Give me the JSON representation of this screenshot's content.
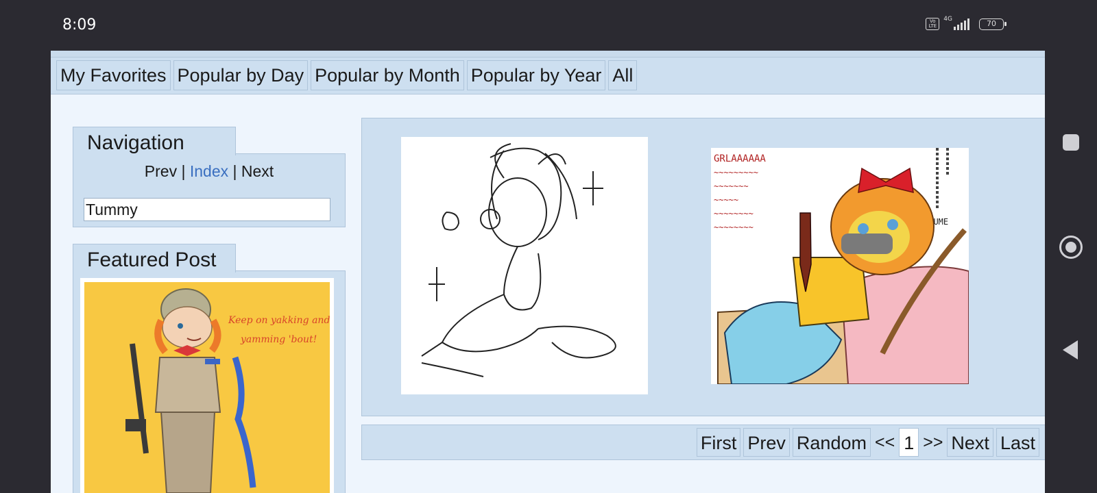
{
  "status_bar": {
    "time": "8:09",
    "volte": "Vo LTE",
    "network": "4G",
    "battery": "70"
  },
  "tabs": [
    "My Favorites",
    "Popular by Day",
    "Popular by Month",
    "Popular by Year",
    "All"
  ],
  "navigation": {
    "title": "Navigation",
    "prev": "Prev",
    "index": "Index",
    "next": "Next",
    "separator": "|",
    "search_value": "Tummy"
  },
  "featured": {
    "title": "Featured Post",
    "caption_line1": "Keep on yakking and",
    "caption_line2": "yamming 'bout!"
  },
  "thumbs": [
    {
      "icon": "sketch-girl-image"
    },
    {
      "icon": "colored-drawing-image",
      "scrawl_line1": "GRLAAAAAA",
      "scrawl_line2": "AYUME"
    }
  ],
  "pager": {
    "first": "First",
    "prev": "Prev",
    "random": "Random",
    "back_arrows": "<<",
    "current_page": "1",
    "fwd_arrows": ">>",
    "next": "Next",
    "last": "Last"
  },
  "colors": {
    "page_bg": "#eef5fd",
    "panel": "#cddff0",
    "border": "#aec4da",
    "link": "#3a6fc0",
    "featured_bg": "#f8c842"
  }
}
